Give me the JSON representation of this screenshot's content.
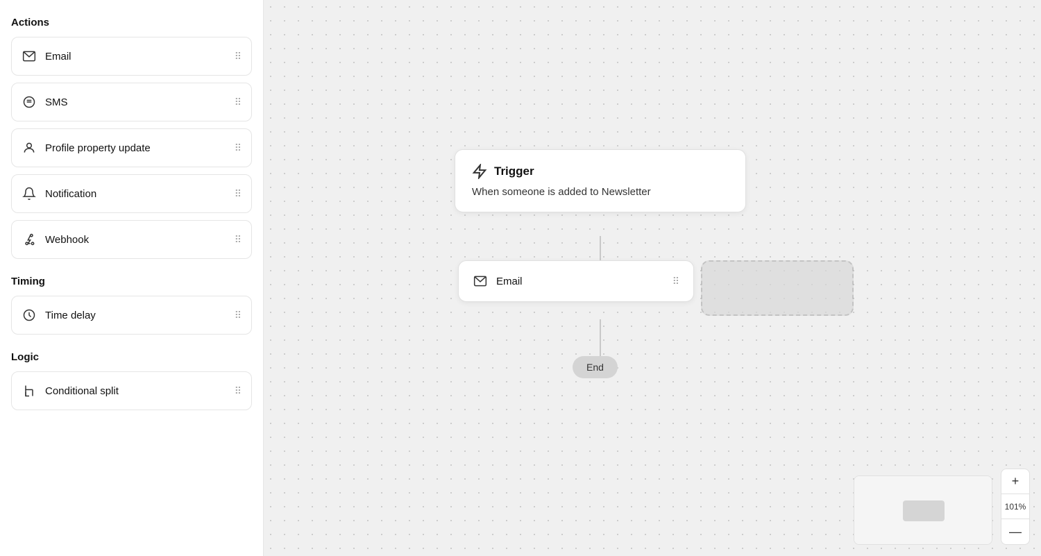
{
  "sidebar": {
    "actions_title": "Actions",
    "timing_title": "Timing",
    "logic_title": "Logic",
    "items": [
      {
        "id": "email",
        "label": "Email",
        "icon": "email-icon"
      },
      {
        "id": "sms",
        "label": "SMS",
        "icon": "sms-icon"
      },
      {
        "id": "profile-property-update",
        "label": "Profile property update",
        "icon": "profile-icon"
      },
      {
        "id": "notification",
        "label": "Notification",
        "icon": "notification-icon"
      },
      {
        "id": "webhook",
        "label": "Webhook",
        "icon": "webhook-icon"
      }
    ],
    "timing_items": [
      {
        "id": "time-delay",
        "label": "Time delay",
        "icon": "clock-icon"
      }
    ],
    "logic_items": [
      {
        "id": "conditional-split",
        "label": "Conditional split",
        "icon": "split-icon"
      }
    ]
  },
  "canvas": {
    "trigger_title": "Trigger",
    "trigger_subtitle": "When someone is added to Newsletter",
    "email_node_label": "Email",
    "end_label": "End",
    "zoom_level": "101%",
    "zoom_plus": "+",
    "zoom_minus": "—"
  }
}
